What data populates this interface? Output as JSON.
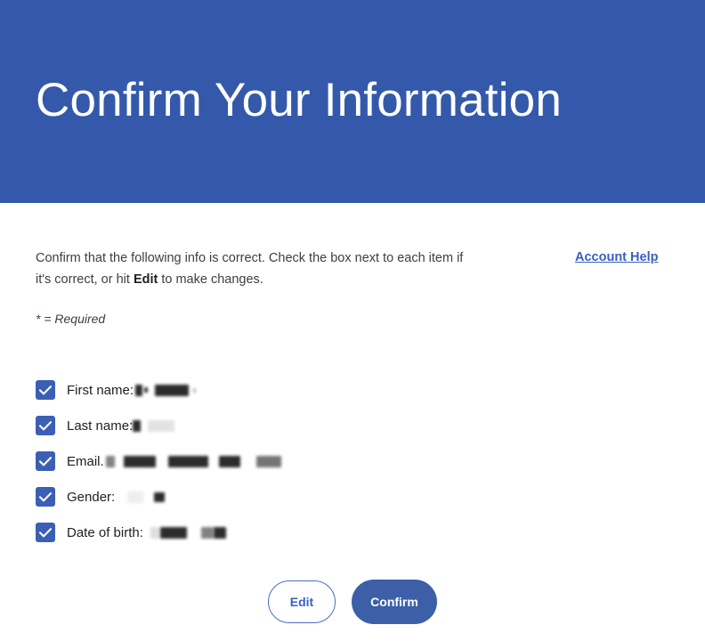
{
  "header": {
    "title": "Confirm Your Information",
    "background_color": "#3459ab",
    "logo": {
      "icon": "envelope-at-icon",
      "envelope_color": "#ffffff",
      "badge_color": "#e0472c",
      "badge_symbol": "@"
    }
  },
  "body": {
    "intro_before_bold": "Confirm that the following info is correct. Check the box next to each item if it's correct, or hit ",
    "intro_bold": "Edit",
    "intro_after_bold": " to make changes.",
    "required_note": "* = Required",
    "account_help_label": "Account Help",
    "account_help_color": "#3b5fc0"
  },
  "checklist": {
    "checkbox_color": "#3b5fb5",
    "check_icon": "checkmark-icon",
    "items": [
      {
        "label": "First name:",
        "checked": true,
        "redacted_value": true,
        "redaction_widths": [
          8,
          4,
          38
        ]
      },
      {
        "label": "Last name:",
        "checked": true,
        "redacted_value": true,
        "redaction_widths": [
          9,
          30
        ]
      },
      {
        "label": "Email.",
        "checked": true,
        "redacted_value": true,
        "redaction_widths": [
          10,
          6,
          36,
          8,
          45,
          6,
          24,
          14,
          28
        ]
      },
      {
        "label": "Gender:",
        "checked": true,
        "redacted_value": true,
        "redaction_widths": [
          18,
          8,
          12
        ]
      },
      {
        "label": "Date of birth:",
        "checked": true,
        "redacted_value": true,
        "redaction_widths": [
          10,
          30,
          14,
          22
        ]
      }
    ]
  },
  "actions": {
    "edit_label": "Edit",
    "confirm_label": "Confirm",
    "edit_color": "#3b5fc0",
    "confirm_color": "#3c5fa8"
  }
}
